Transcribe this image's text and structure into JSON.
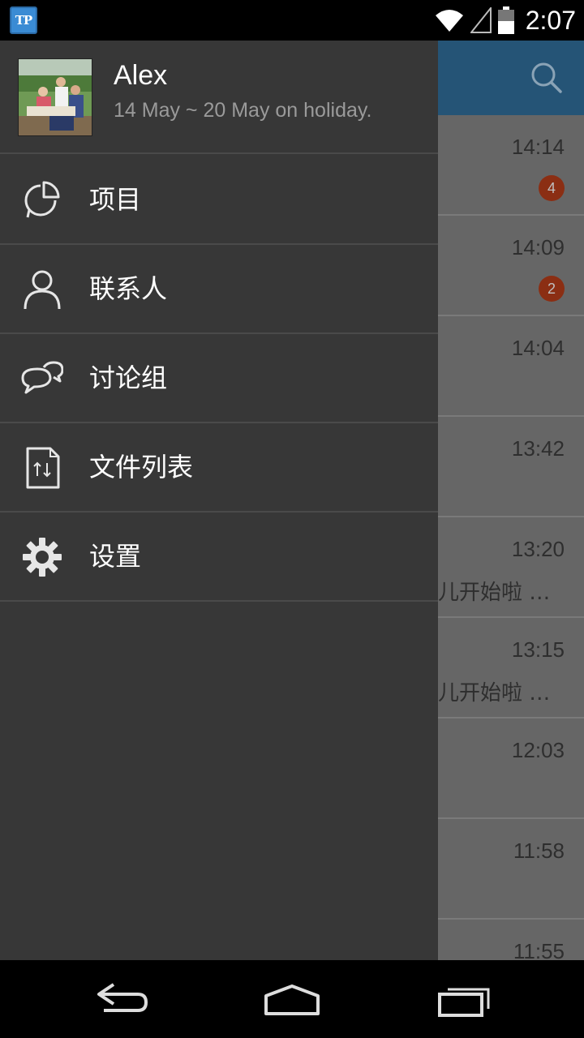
{
  "status_bar": {
    "app_icon_text": "TP",
    "time": "2:07",
    "icons": [
      "wifi-icon",
      "signal-icon",
      "battery-icon"
    ]
  },
  "drawer": {
    "profile": {
      "name": "Alex",
      "status": "14 May ~ 20 May on holiday."
    },
    "menu": [
      {
        "label": "项目",
        "icon": "pie-chart-icon"
      },
      {
        "label": "联系人",
        "icon": "person-icon"
      },
      {
        "label": "讨论组",
        "icon": "chat-bubbles-icon"
      },
      {
        "label": "文件列表",
        "icon": "file-transfer-icon"
      },
      {
        "label": "设置",
        "icon": "gear-icon"
      }
    ]
  },
  "background_list": {
    "rows": [
      {
        "time": "14:14",
        "badge": "4",
        "preview": ""
      },
      {
        "time": "14:09",
        "badge": "2",
        "preview": ""
      },
      {
        "time": "14:04",
        "badge": "",
        "preview": ""
      },
      {
        "time": "13:42",
        "badge": "",
        "preview": ""
      },
      {
        "time": "13:20",
        "badge": "",
        "preview": "儿开始啦 …"
      },
      {
        "time": "13:15",
        "badge": "",
        "preview": "儿开始啦 …"
      },
      {
        "time": "12:03",
        "badge": "",
        "preview": ""
      },
      {
        "time": "11:58",
        "badge": "",
        "preview": ""
      },
      {
        "time": "11:55",
        "badge": "",
        "preview": ""
      }
    ]
  },
  "colors": {
    "drawer_bg": "#373737",
    "header_blue": "#255476",
    "badge_red": "#8b2e13"
  }
}
